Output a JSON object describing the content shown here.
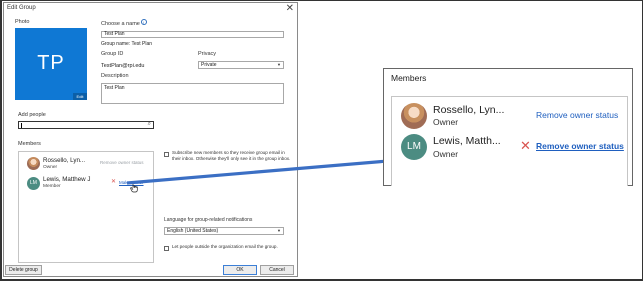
{
  "dialog": {
    "title": "Edit Group",
    "close_glyph": "✕",
    "photo_label": "Photo",
    "photo_initials": "TP",
    "photo_edit_label": "Edit",
    "choose_name_label": "Choose a name",
    "name_value": "Test Plan",
    "group_name_line": "Group name: Test Plan",
    "group_id_label": "Group ID",
    "group_id_value": "TestPlan@rpi.edu",
    "privacy_label": "Privacy",
    "privacy_value": "Private",
    "description_label": "Description",
    "description_value": "Test Plan",
    "add_people_label": "Add people",
    "members_label": "Members",
    "members": [
      {
        "name": "Rossello, Lyn...",
        "role": "Owner",
        "action": "Remove owner status"
      },
      {
        "name": "Lewis, Matthew J",
        "role": "Member",
        "action": "Make owner",
        "initials": "LM"
      }
    ],
    "subscribe_text": "Subscribe new members so they receive group email in their inbox. Otherwise they'll only see it in the group inbox.",
    "language_label": "Language for group-related notifications",
    "language_value": "English (United States)",
    "outside_text": "Let people outside the organization email the group.",
    "delete_button": "Delete group",
    "ok_button": "OK",
    "cancel_button": "Cancel"
  },
  "zoom": {
    "heading": "Members",
    "members": [
      {
        "name": "Rossello, Lyn...",
        "role": "Owner",
        "action": "Remove owner status"
      },
      {
        "name": "Lewis, Matth...",
        "role": "Owner",
        "action": "Remove owner status",
        "initials": "LM"
      }
    ]
  },
  "colors": {
    "accent": "#0f78d4",
    "link": "#1f5fbf",
    "remove_x": "#d9534f",
    "avatar_lm": "#4c8c82",
    "arrow": "#3b6fc4"
  }
}
